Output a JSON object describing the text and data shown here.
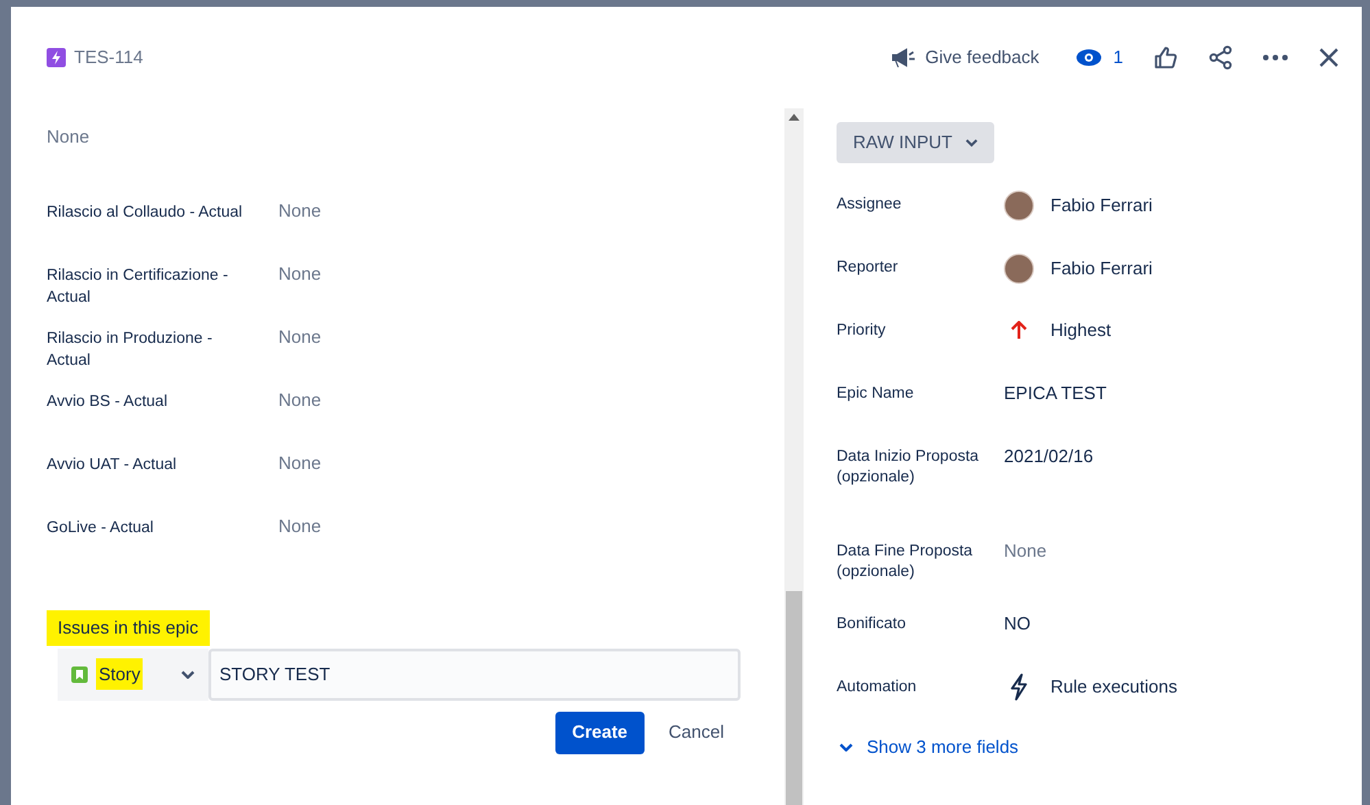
{
  "header": {
    "issue_key": "TES-114",
    "feedback": "Give feedback",
    "watchers": "1"
  },
  "left_fields": [
    {
      "value": "None"
    },
    {
      "label": "Rilascio al Collaudo - Actual",
      "value": "None"
    },
    {
      "label": "Rilascio in Certificazione - Actual",
      "value": "None"
    },
    {
      "label": "Rilascio in Produzione - Actual",
      "value": "None"
    },
    {
      "label": "Avvio BS - Actual",
      "value": "None"
    },
    {
      "label": "Avvio UAT - Actual",
      "value": "None"
    },
    {
      "label": "GoLive - Actual",
      "value": "None"
    }
  ],
  "child_issues": {
    "title": "Issues in this epic",
    "title_highlighted": true,
    "issue_type": "Story",
    "type_highlighted": true,
    "summary": "STORY TEST",
    "create": "Create",
    "cancel": "Cancel"
  },
  "status_button": "RAW INPUT",
  "right_fields": [
    {
      "label": "Assignee",
      "value": "Fabio Ferrari",
      "kind": "user"
    },
    {
      "label": "Reporter",
      "value": "Fabio Ferrari",
      "kind": "user"
    },
    {
      "label": "Priority",
      "value": "Highest",
      "kind": "priority"
    },
    {
      "label": "Epic Name",
      "value": "EPICA TEST",
      "kind": "text"
    },
    {
      "label": "Data Inizio Proposta (opzionale)",
      "value": "2021/02/16",
      "kind": "text"
    },
    {
      "label": "Data Fine Proposta (opzionale)",
      "value": "None",
      "kind": "empty"
    },
    {
      "label": "Bonificato",
      "value": "NO",
      "kind": "text"
    },
    {
      "label": "Automation",
      "value": "Rule executions",
      "kind": "automation"
    }
  ],
  "more_fields": "Show 3 more fields"
}
